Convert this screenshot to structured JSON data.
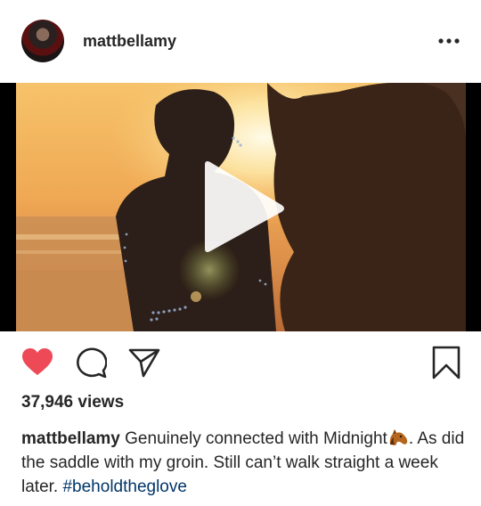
{
  "post": {
    "username": "mattbellamy",
    "views": "37,946 views",
    "caption": {
      "username": "mattbellamy",
      "text_1": "Genuinely connected with Midnight",
      "emoji": "horse-face-emoji",
      "text_2": ". As did the saddle with my groin. Still can’t walk straight a week later. ",
      "hashtag": "#beholdtheglove"
    },
    "liked": true
  },
  "icons": {
    "more": "more-options-icon",
    "like": "heart-icon",
    "comment": "comment-icon",
    "share": "share-icon",
    "save": "bookmark-icon",
    "play": "play-icon"
  },
  "colors": {
    "like_red": "#ed4956",
    "hashtag_blue": "#003569",
    "text": "#262626"
  }
}
